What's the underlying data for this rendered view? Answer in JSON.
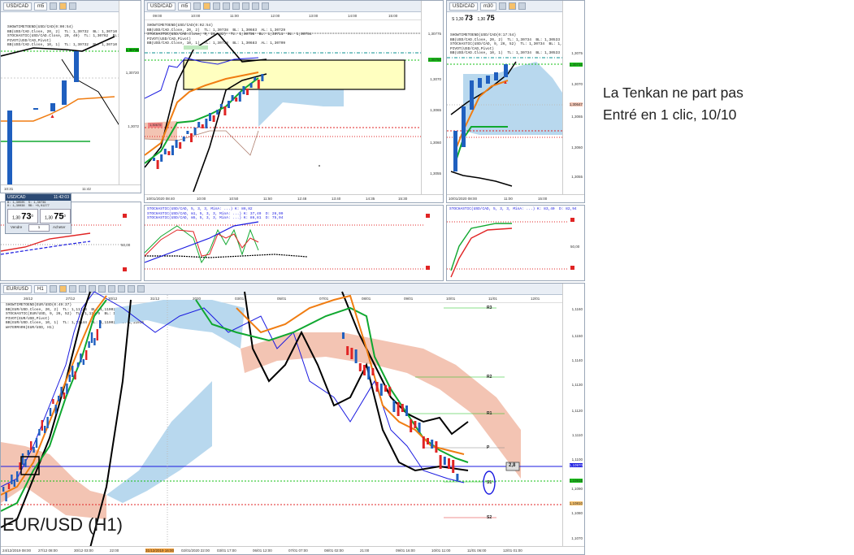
{
  "annotation": {
    "line1": "La Tenkan ne part pas",
    "line2": "Entré en 1 clic, 10/10"
  },
  "panels": {
    "p1": {
      "symbol": "USD/CAD",
      "timeframe": "m5",
      "legend": "SHOWTIMETOEND(USD/CAD(0:00:54)\nBB(USD/CAD.Close, 20, 2)  TL: 1,30732  BL: 1,30710  AL: 1,\nSTOCHASTIC(USD/CAD.Close, 20, 40)  TL: 1,30762  BL: 1,30718  CS: 1,3\nPIVOT(USD/CAD,Pivot)\nBB(USD/CAD.Close, 10, 1)  TL: 1,30732  BL: 1,30710  AL: 1,",
      "prices": [
        "1,30735",
        "1,30720",
        "1,3072"
      ],
      "times": [
        "10:31",
        "11:42"
      ],
      "stoch_title": "STOCHASTIC(USD/CAD, 5, 3, 3, MinA: ...) K: 86,82",
      "stoch_level": "50,00"
    },
    "p2": {
      "symbol": "USD/CAD",
      "timeframe": "m5",
      "legend": "SHOWTIMETOEND(USD/CAD(0:02:54)\nBB(USD/CAD.Close, 20, 2)  TL: 1,30738  BL: 1,30683  AL: 1,30729\nSTOCHASTIC(USD/CAD.Close, 9, 26, 52)  TL: 1,30738  BL: 1,30711  BL: 1,30734\nPIVOT(USD/CAD,Pivot)\nBB(USD/CAD.Close, 10, 1)  TL: 1,30738  BL: 1,30683  AL: 1,30709",
      "top_times": [
        "09:00",
        "10:00",
        "11:00",
        "12:00",
        "13:00",
        "14:00",
        "15:00"
      ],
      "prices": [
        "1,30775",
        "1,30750",
        "1,3070",
        "1,3065",
        "1,3060",
        "1,3055"
      ],
      "times": [
        "10/01/2020 08:40",
        "10:00",
        "10:50",
        "11:50",
        "12:48",
        "13:40",
        "14:35",
        "15:30"
      ],
      "pivot_label": "1,30675",
      "stoch_title": "STOCHASTIC(USD/CAD, 5, 3, 3, MinA: ...) K: 86,82\nSTOCHASTIC(USD/CAD, m1, 5, 3, 3, MinA: ...) K: 37,49  D: 26,09\nSTOCHASTIC(USD/CAD, m5, 5, 3, 3, MinA: ...) K: 86,81  D: 75,04"
    },
    "p3": {
      "symbol": "USD/CAD",
      "timeframe": "m30",
      "sell_label": "S",
      "sell_price": "1,30",
      "sell_big": "73",
      "buy_price": "1,30",
      "buy_big": "75",
      "legend": "SHOWTIMETOEND(USD/CAD(0:17:54)\nBB(USD/CAD.Close, 20, 2)  TL: 1,30734  BL: 1,30533  AL: 1,30\nSTOCHASTIC(USD/CAD, 9, 26, 52)  TL: 1,30734  BL: 1,30651  CS: 1,307\nPIVOT(USD/CAD,Pivot)\nBB(USD/CAD.Close, 10, 1)  TL: 1,30734  BL: 1,30533  AL: 1,30",
      "prices": [
        "1,3075",
        "1,3070",
        "1,3065",
        "1,3060",
        "1,3055"
      ],
      "price_tags": [
        "1,30734",
        "1,30647"
      ],
      "times": [
        "10/01/2020 08:00",
        "11:00",
        "15:00"
      ],
      "stoch_title": "STOCHASTIC(USD/CAD, 5, 3, 3, MinA: ...) K: 83,40  D: 82,94",
      "stoch_level": "50,00"
    },
    "p4": {
      "symbol": "EUR/USD",
      "timeframe": "H1",
      "watermark": "EUR/USD (H1)",
      "legend": "SHOWTIMETOEND(EUR/USD(0:49:37)\nBB(EUR/USD.Close, 20, 2)  TL: 1,11144  BL: 1,11002  AL: 1,11035\nSTOCHASTIC(EUR/USD, 9, 26, 52)  TL: 1,11079  BL: 1,10991  CS: 1,11144\nPIVOT(EUR/USD,Pivot)\nBB(EUR/USD.Close, 10, 1)  TL: 1,11144  BL: 1,11002  AL: 1,11035\nWATERMARK(EUR/USD, H1)",
      "top_dates": [
        "26/12",
        "27/12",
        "30/12",
        "31/12",
        "2020",
        "03/01",
        "05/01",
        "07/01",
        "08/01",
        "09/01",
        "10/01",
        "11/01",
        "12/01"
      ],
      "prices": [
        "1,1160",
        "1,1150",
        "1,1140",
        "1,1130",
        "1,1120",
        "1,1110",
        "1,1100",
        "1,1090",
        "1,1080",
        "1,1070"
      ],
      "price_tags": [
        "1,10970",
        "1,10915",
        "1,10810"
      ],
      "levels": [
        "R3",
        "R2",
        "R1",
        "P",
        "S1",
        "S2"
      ],
      "box_value": "2,8",
      "times": [
        "24/12/2019 08:00",
        "27/12 08:00",
        "30/12 03:00",
        "22:00",
        "31/12/2019 16:00",
        "02/01/2020 22:00",
        "03/01 17:00",
        "06/01 12:00",
        "07/01 07:00",
        "08/01 02:00",
        "21:00",
        "09/01 16:00",
        "10/01 11:00",
        "11/01 06:00",
        "12/01 01:00"
      ],
      "highlight_time": "31/12/2019 16:00"
    }
  },
  "ticket": {
    "symbol": "USD/CAD",
    "time": "11:42:03",
    "bid_small": "1,30",
    "bid_big": "73",
    "bid_sup": "0",
    "ask_small": "1,30",
    "ask_big": "75",
    "ask_sup": "0",
    "sell_label": "Vendre",
    "buy_label": "Acheter",
    "qty": "1",
    "stats": "B: 1,30505  S: 1,30739\nH: 1,30038  RB: +0,01277"
  },
  "colors": {
    "bull_candle": "#1f5fbf",
    "bear_candle": "#e02424",
    "kijun": "#10a830",
    "tenkan": "#f07d12",
    "bb": "#000000",
    "cloud_bull": "#b8d8ee",
    "cloud_bear": "#f3c4b3",
    "ma_blue": "#1a1ae0"
  }
}
